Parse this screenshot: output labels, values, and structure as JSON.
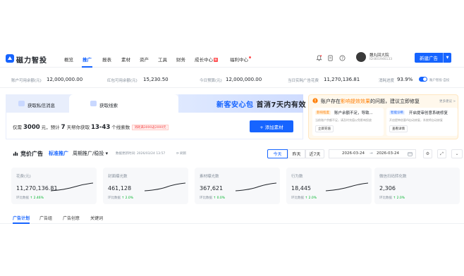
{
  "app": {
    "brand": "磁力智投"
  },
  "nav": [
    {
      "label": "概览",
      "active": false
    },
    {
      "label": "推广",
      "active": true
    },
    {
      "label": "报表",
      "active": false
    },
    {
      "label": "素材",
      "active": false
    },
    {
      "label": "资产",
      "active": false
    },
    {
      "label": "工具",
      "active": false
    },
    {
      "label": "财务",
      "active": false
    },
    {
      "label": "成长中心",
      "active": false
    },
    {
      "label": "福利中心",
      "active": false
    }
  ],
  "nav_badge": "新",
  "user": {
    "name": "魏丸回大院",
    "id": "ID:801946133"
  },
  "new_ad_button": "新建广告",
  "stats": [
    {
      "label": "账户可用余额(元)",
      "value": "12,000,000.00"
    },
    {
      "label": "红包可用余额(元)",
      "value": "15,230.50"
    },
    {
      "label": "今日预算(元)",
      "value": "12,000,000.00"
    },
    {
      "label": "当日实耗广告花费",
      "value": "11,270,136.81"
    },
    {
      "label": "消耗进度",
      "value": "93.9%"
    },
    {
      "label": "账户智投·自投",
      "value": ""
    }
  ],
  "promo": {
    "tab1": "获取私信消息",
    "tab2": "获取线索",
    "banner_part1": "新客安心包",
    "banner_part2": "首消7天内有效",
    "budget_prefix": "仅需",
    "budget_amount": "3000",
    "budget_mid1": "元，预计",
    "budget_days": "7",
    "budget_mid2": "天帮你获取",
    "budget_range": "13-43",
    "budget_suffix": "个线索数",
    "budget_tag": "消耗满3000返2000元",
    "add_button": "+ 添加素材"
  },
  "alert": {
    "title_prefix": "账户存在",
    "title_warn": "影响提效效果",
    "title_suffix": "的问题，建议立即修复",
    "more": "更多建议 >",
    "card1": {
      "tag": "影响程度",
      "text": "账户余额不足，导致...",
      "sub": "当前账户余额不足，请及时充值以免影响投放",
      "button": "立即充值"
    },
    "card2": {
      "tag": "智能诊断",
      "text": "开启提审创意系统修复",
      "sub": "开启提审创意AI自动修复，系统将自动修复",
      "button": "查看详情"
    }
  },
  "section": {
    "title": "竞价广告",
    "type": "标准推广",
    "mode": "周期推广/稳投 ▾",
    "updated": "数据更新时间: 2026/03/24 13:57",
    "refresh": "⟳ 刷新",
    "segments": [
      "今天",
      "昨天",
      "近7天"
    ],
    "date_from": "2026-03-24",
    "date_to": "2026-03-24",
    "date_sep": "→"
  },
  "metrics": [
    {
      "label": "花费(元)",
      "value": "11,270,136.81",
      "cmp_label": "环比数据",
      "cmp": "↑ 2.46%"
    },
    {
      "label": "封面曝光数",
      "value": "461,128",
      "cmp_label": "环比数据",
      "cmp": "↑ 2.0%"
    },
    {
      "label": "素材曝光数",
      "value": "367,621",
      "cmp_label": "环比数据",
      "cmp": "↑ 0.0%"
    },
    {
      "label": "行为数",
      "value": "18,445",
      "cmp_label": "环比数据",
      "cmp": "↑ 2.0%"
    },
    {
      "label": "微信扫码转化数",
      "value": "2,306",
      "cmp_label": "环比数据",
      "cmp": "↑ 2.0%"
    }
  ],
  "bottom_tabs": [
    {
      "label": "广告计划",
      "active": true
    },
    {
      "label": "广告组",
      "active": false
    },
    {
      "label": "广告创意",
      "active": false
    },
    {
      "label": "关键词",
      "active": false
    }
  ],
  "colors": {
    "primary": "#1664ff",
    "warn": "#ff7d00",
    "danger": "#f53f3f",
    "up": "#00b42a"
  }
}
